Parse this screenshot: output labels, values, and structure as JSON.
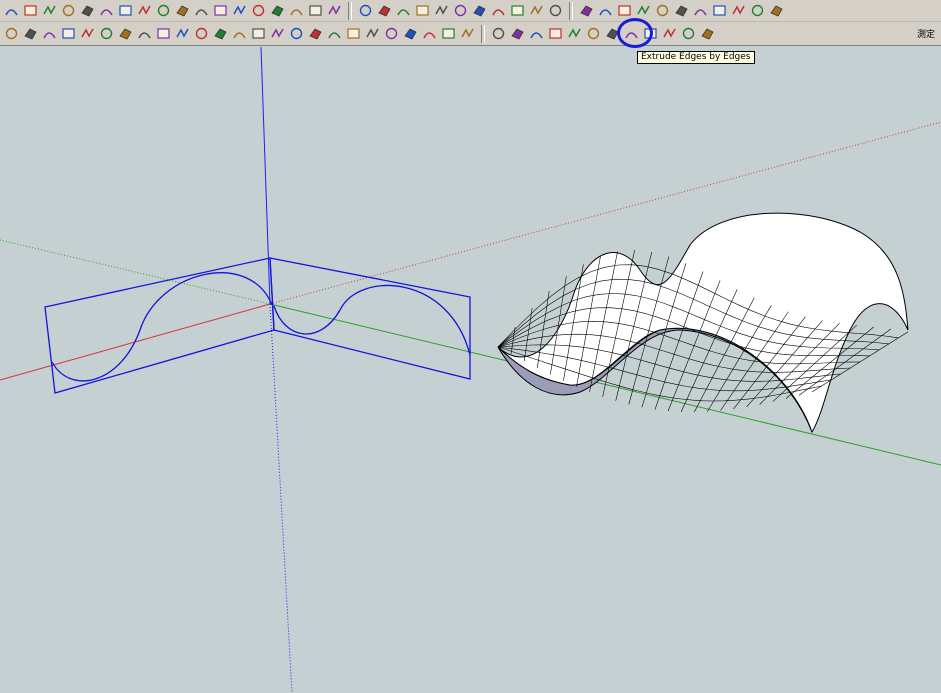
{
  "toolbar_row1": {
    "icons": [
      "arc-curve-icon",
      "polyline-icon",
      "freehand-icon",
      "zigzag-icon",
      "bezier-icon",
      "arc-icon",
      "rectangle-icon",
      "spiral-icon",
      "curve-icon",
      "zigzag-line-icon",
      "hook-curve-icon",
      "curve-2-icon",
      "arc-2-icon",
      "sketch-line-icon",
      "polygon-icon",
      "wrench-icon",
      "oval-icon",
      "triangle-icon",
      "new-file-icon",
      "open-file-icon",
      "save-icon",
      "cut-icon",
      "copy-icon",
      "paste-icon",
      "delete-icon",
      "undo-icon",
      "redo-icon",
      "print-icon",
      "info-icon",
      "box-orange-icon",
      "box-view-icon",
      "box-tools-icon",
      "axis-red-icon",
      "axis-green-icon",
      "axis-n-icon",
      "rotate-left-icon",
      "rotate-right-icon",
      "shell-icon",
      "lock-icon",
      "bird-icon"
    ]
  },
  "toolbar_row2": {
    "icons": [
      "component-icon",
      "eraser-icon",
      "paint-icon",
      "pencil-icon",
      "rectangle-small-icon",
      "circle-small-icon",
      "polygon-small-icon",
      "ellipse-small-icon",
      "parallelogram-icon",
      "arc-small-icon",
      "circle-dot-icon",
      "tape-icon",
      "lasso-icon",
      "offset-icon",
      "scale-icon",
      "paint-bucket-icon",
      "push-pull-icon",
      "follow-me-icon",
      "move-up-icon",
      "move-down-icon",
      "stretch-icon",
      "flip-icon",
      "rotate-icon",
      "undo-red-icon",
      "section-icon",
      "extrude-edges-by-edges-icon",
      "extrude-curve-icon",
      "extrude-tube-icon",
      "extrude-surface-icon",
      "extrude-line-icon",
      "extrude-grid-icon",
      "extrude-profile-icon",
      "extrude-loft-icon",
      "extrude-skin-icon",
      "extrude-mesh-icon",
      "extrude-fan-icon",
      "extrude-tools-icon"
    ],
    "highlighted_icon": "extrude-edges-by-edges-icon"
  },
  "tooltip": {
    "text": "Extrude Edges by Edges"
  },
  "status": {
    "text": "測定"
  },
  "colors": {
    "background": "#c5d0d2",
    "axis_blue": "#1e1eff",
    "axis_red": "#d23232",
    "axis_green": "#2aa02a",
    "highlight": "#1a1ad8"
  }
}
